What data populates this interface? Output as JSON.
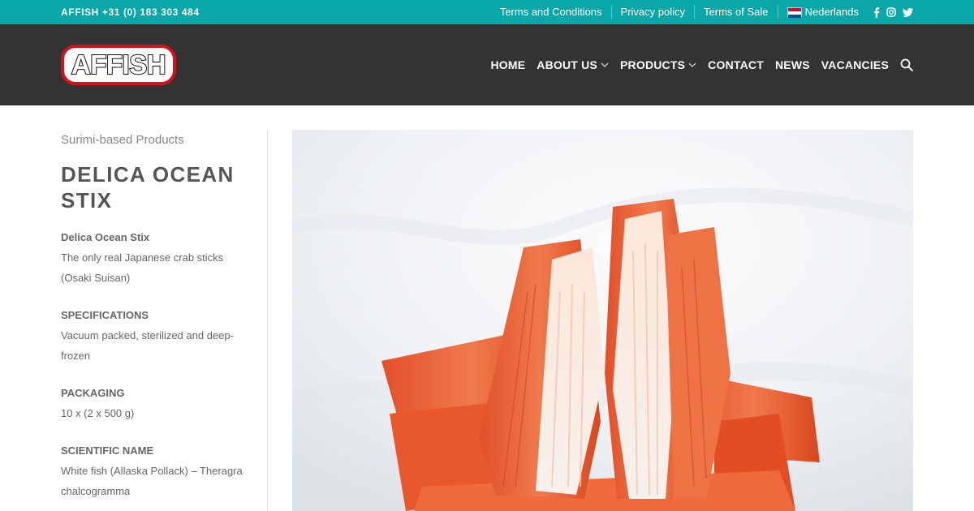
{
  "topbar": {
    "phone": "AFFISH +31 (0) 183 303 484",
    "links": [
      "Terms and Conditions",
      "Privacy policy",
      "Terms of Sale"
    ],
    "language": "Nederlands",
    "social_icons": [
      "facebook-icon",
      "instagram-icon",
      "twitter-icon"
    ]
  },
  "header": {
    "logo_text": "AFFISH",
    "nav": {
      "home": "HOME",
      "about": "ABOUT US",
      "products": "PRODUCTS",
      "contact": "CONTACT",
      "news": "NEWS",
      "vacancies": "VACANCIES"
    }
  },
  "product": {
    "category": "Surimi-based Products",
    "title": "DELICA OCEAN STIX",
    "intro_name": "Delica Ocean Stix",
    "intro_text": "The only real Japanese crab sticks (Osaki Suisan)",
    "specs_label": "SPECIFICATIONS",
    "specs_text": "Vacuum packed, sterilized and deep-frozen",
    "packaging_label": "PACKAGING",
    "packaging_text": "10 x (2 x 500 g)",
    "scientific_label": "SCIENTIFIC NAME",
    "scientific_text": "White fish (Allaska Pollack) – Theragra chalcogramma"
  },
  "colors": {
    "topbar": "#0aa7a9",
    "header": "#333333",
    "logo_red": "#d6111c"
  }
}
